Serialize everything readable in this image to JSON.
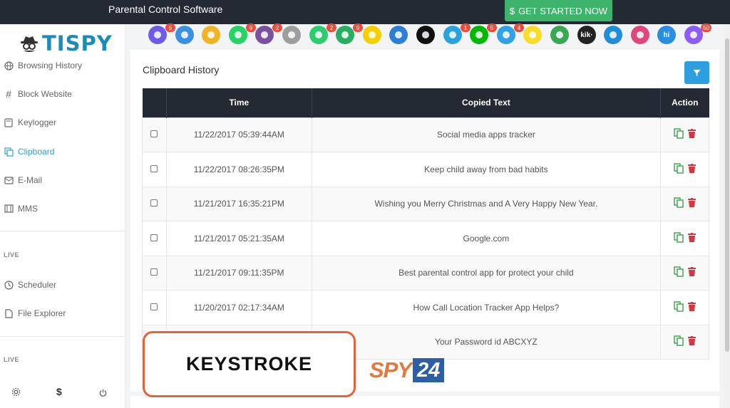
{
  "topbar": {
    "title": "Parental Control Software",
    "cta_icon": "$",
    "cta_label": "GET STARTED NOW"
  },
  "logo": {
    "text": "TISPY",
    "icon": "spy-icon"
  },
  "sidebar": {
    "items": [
      {
        "label": "Browsing History",
        "icon": "globe-icon"
      },
      {
        "label": "Block Website",
        "icon": "hash-icon"
      },
      {
        "label": "Keylogger",
        "icon": "keylogger-icon"
      },
      {
        "label": "Clipboard",
        "icon": "clipboard-icon",
        "active": true
      },
      {
        "label": "E-Mail",
        "icon": "mail-icon"
      },
      {
        "label": "MMS",
        "icon": "film-icon"
      }
    ],
    "section1": "LIVE",
    "items2": [
      {
        "label": "Scheduler",
        "icon": "clock-icon"
      },
      {
        "label": "File Explorer",
        "icon": "file-icon"
      }
    ],
    "section2": "LIVE",
    "footer": {
      "dollar": "$"
    }
  },
  "apps": [
    {
      "name": "phone",
      "badge": "5",
      "color": "#6c5ce7"
    },
    {
      "name": "mail",
      "badge": "",
      "color": "#3d8fe0"
    },
    {
      "name": "copy",
      "badge": "",
      "color": "#f0b429"
    },
    {
      "name": "whatsapp",
      "badge": "9",
      "color": "#25d366"
    },
    {
      "name": "viber",
      "badge": "2",
      "color": "#7b519d"
    },
    {
      "name": "clipboard",
      "badge": "",
      "color": "#9e9e9e"
    },
    {
      "name": "wechat",
      "badge": "2",
      "color": "#2ecc71"
    },
    {
      "name": "wechat2",
      "badge": "9",
      "color": "#27ae60"
    },
    {
      "name": "snapchat",
      "badge": "",
      "color": "#f5d000"
    },
    {
      "name": "flickr",
      "badge": "",
      "color": "#2d7fd6"
    },
    {
      "name": "tiktok",
      "badge": "",
      "color": "#111111"
    },
    {
      "name": "telegram",
      "badge": "1",
      "color": "#2aa3dd"
    },
    {
      "name": "line",
      "badge": "5",
      "color": "#00b900"
    },
    {
      "name": "skype",
      "badge": "4",
      "color": "#2fa3e6"
    },
    {
      "name": "kakao",
      "badge": "",
      "color": "#f7dc2a"
    },
    {
      "name": "hangouts",
      "badge": "",
      "color": "#3aa757"
    },
    {
      "name": "kik",
      "badge": "",
      "color": "#222222",
      "label": "kik·"
    },
    {
      "name": "imo",
      "badge": "",
      "color": "#1f8ed6"
    },
    {
      "name": "video",
      "badge": "",
      "color": "#e0457b"
    },
    {
      "name": "hike",
      "badge": "",
      "color": "#2b8de0",
      "label": "hi"
    },
    {
      "name": "messenger",
      "badge": "50",
      "color": "#8b5cf6"
    }
  ],
  "panel": {
    "title": "Clipboard History"
  },
  "table": {
    "headers": {
      "time": "Time",
      "text": "Copied Text",
      "action": "Action"
    },
    "rows": [
      {
        "time": "11/22/2017 05:39:44AM",
        "text": "Social media apps tracker"
      },
      {
        "time": "11/22/2017 08:26:35PM",
        "text": "Keep child away from bad habits"
      },
      {
        "time": "11/21/2017 16:35:21PM",
        "text": "Wishing you Merry Christmas and A Very Happy New Year."
      },
      {
        "time": "11/21/2017 05:21:35AM",
        "text": "Google.com"
      },
      {
        "time": "11/21/2017 09:11:35PM",
        "text": "Best parental control app for protect your child"
      },
      {
        "time": "11/20/2017 02:17:34AM",
        "text": "How Call Location Tracker App Helps?"
      },
      {
        "time": "",
        "text": "Your Password id ABCXYZ"
      }
    ]
  },
  "overlay": {
    "keystroke": "KEYSTROKE",
    "spy": "SPY",
    "num": "24"
  }
}
